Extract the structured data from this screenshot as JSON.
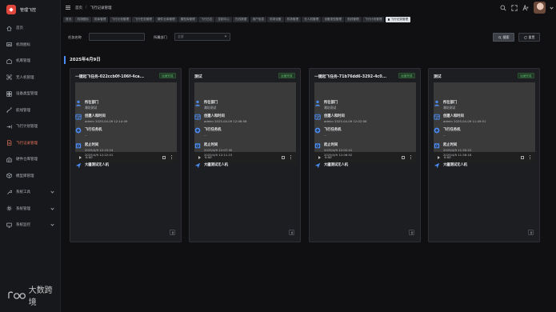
{
  "sidebar": {
    "logo_text": "管理飞控",
    "items": [
      {
        "label": "首页",
        "icon": "home-icon",
        "has_children": false,
        "active": false
      },
      {
        "label": "机场图标",
        "icon": "airport-icon",
        "has_children": false,
        "active": false
      },
      {
        "label": "机库管理",
        "icon": "hangar-icon",
        "has_children": false,
        "active": false
      },
      {
        "label": "无人机管理",
        "icon": "drone-icon",
        "has_children": false,
        "active": false
      },
      {
        "label": "设备类型管理",
        "icon": "device-type-icon",
        "has_children": false,
        "active": false
      },
      {
        "label": "航线管理",
        "icon": "route-icon",
        "has_children": false,
        "active": false
      },
      {
        "label": "飞行计划管理",
        "icon": "plan-icon",
        "has_children": false,
        "active": false
      },
      {
        "label": "飞行记录管理",
        "icon": "record-icon",
        "has_children": false,
        "active": true
      },
      {
        "label": "硬件仓库管理",
        "icon": "warehouse-icon",
        "has_children": false,
        "active": false
      },
      {
        "label": "模型库管理",
        "icon": "model-icon",
        "has_children": false,
        "active": false
      },
      {
        "label": "系统工具",
        "icon": "tools-icon",
        "has_children": true,
        "active": false
      },
      {
        "label": "系统管理",
        "icon": "settings-icon",
        "has_children": true,
        "active": false
      },
      {
        "label": "系统监控",
        "icon": "monitor-icon",
        "has_children": true,
        "active": false
      }
    ]
  },
  "watermark": "大数跨境",
  "header": {
    "breadcrumb": [
      "首页",
      "飞行记录管理"
    ]
  },
  "tags": [
    "首页",
    "机场图标",
    "机库管理",
    "飞行计划管理",
    "飞行任务管理",
    "硬件仓库管理",
    "模型库管理",
    "飞行日志",
    "控制中心",
    "在线数据",
    "用户信息",
    "机场设备",
    "机场管理",
    "无人机管理",
    "设备类型管理",
    "航线管理",
    "飞行计划管理",
    "飞行记录管理"
  ],
  "search": {
    "task_name_label": "任务名称",
    "task_name_value": "",
    "dept_label": "所属部门",
    "dept_placeholder": "全部",
    "search_label": "搜索",
    "reset_label": "重置"
  },
  "date_heading": "2025年4月9日",
  "cards": [
    {
      "title": "一键起飞任务-022ccb0f-106f-4ca...",
      "status": "运营完成",
      "video_time": "0:00",
      "dept_label": "所在部门",
      "dept_value": "潍坊测试",
      "creator_label": "创建人和时间",
      "creator_value": "admin 2025-04-09 12:14:49",
      "drone_label": "飞行任务机",
      "drone_value": "--",
      "time_label": "起止时间",
      "start": "2025/4/9 12:15:24",
      "end": "2025/4/9 12:22:01",
      "aircraft": "大疆测试无人机"
    },
    {
      "title": "测试",
      "status": "运营完成",
      "video_time": "0:00",
      "dept_label": "所在部门",
      "dept_value": "潍坊测试",
      "creator_label": "创建人和时间",
      "creator_value": "admin 2025-04-09 12:06:56",
      "drone_label": "飞行任务机",
      "drone_value": "--",
      "time_label": "起止时间",
      "start": "2025/4/9 12:07:30",
      "end": "2025/4/9 12:11:15",
      "aircraft": "大疆测试无人机"
    },
    {
      "title": "一键起飞任务-71b76dd6-3292-4c0...",
      "status": "运营完成",
      "video_time": "0:00",
      "dept_label": "所在部门",
      "dept_value": "潍坊测试",
      "creator_label": "创建人和时间",
      "creator_value": "admin 2025-04-09 12:02:06",
      "drone_label": "飞行任务机",
      "drone_value": "--",
      "time_label": "起止时间",
      "start": "2025/4/9 12:02:41",
      "end": "2025/4/9 12:06:52",
      "aircraft": "大疆测试无人机"
    },
    {
      "title": "测试",
      "status": "运营完成",
      "video_time": "0:00",
      "dept_label": "所在部门",
      "dept_value": "潍坊测试",
      "creator_label": "创建人和时间",
      "creator_value": "admin 2025-04-09 11:49:51",
      "drone_label": "飞行任务机",
      "drone_value": "--",
      "time_label": "起止时间",
      "start": "2025/4/9 11:50:22",
      "end": "2025/4/9 11:56:18",
      "aircraft": "大疆测试无人机"
    }
  ]
}
